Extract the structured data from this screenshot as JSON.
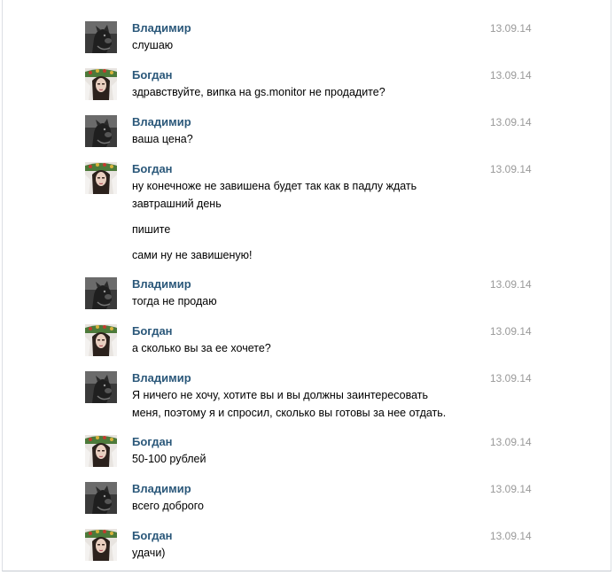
{
  "messages": [
    {
      "author": "Владимир",
      "avatar": "dog-avatar",
      "date": "13.09.14",
      "lines": [
        "слушаю"
      ]
    },
    {
      "author": "Богдан",
      "avatar": "girl-avatar",
      "date": "13.09.14",
      "lines": [
        "здравствуйте, випка на gs.monitor не продадите?"
      ]
    },
    {
      "author": "Владимир",
      "avatar": "dog-avatar",
      "date": "13.09.14",
      "lines": [
        "ваша цена?"
      ]
    },
    {
      "author": "Богдан",
      "avatar": "girl-avatar",
      "date": "13.09.14",
      "lines": [
        "ну конечноже не завишена будет так как в падлу ждать",
        "завтрашний день"
      ],
      "extra": [
        "пишите",
        "сами ну не завишеную!"
      ]
    },
    {
      "author": "Владимир",
      "avatar": "dog-avatar",
      "date": "13.09.14",
      "lines": [
        "тогда не продаю"
      ]
    },
    {
      "author": "Богдан",
      "avatar": "girl-avatar",
      "date": "13.09.14",
      "lines": [
        "а сколько вы за ее хочете?"
      ]
    },
    {
      "author": "Владимир",
      "avatar": "dog-avatar",
      "date": "13.09.14",
      "lines": [
        "Я ничего не хочу, хотите вы и вы должны заинтересовать",
        "меня, поэтому я и спросил, сколько вы готовы за нее отдать."
      ]
    },
    {
      "author": "Богдан",
      "avatar": "girl-avatar",
      "date": "13.09.14",
      "lines": [
        "50-100 рублей"
      ]
    },
    {
      "author": "Владимир",
      "avatar": "dog-avatar",
      "date": "13.09.14",
      "lines": [
        "всего доброго"
      ]
    },
    {
      "author": "Богдан",
      "avatar": "girl-avatar",
      "date": "13.09.14",
      "lines": [
        "удачи)"
      ]
    }
  ]
}
